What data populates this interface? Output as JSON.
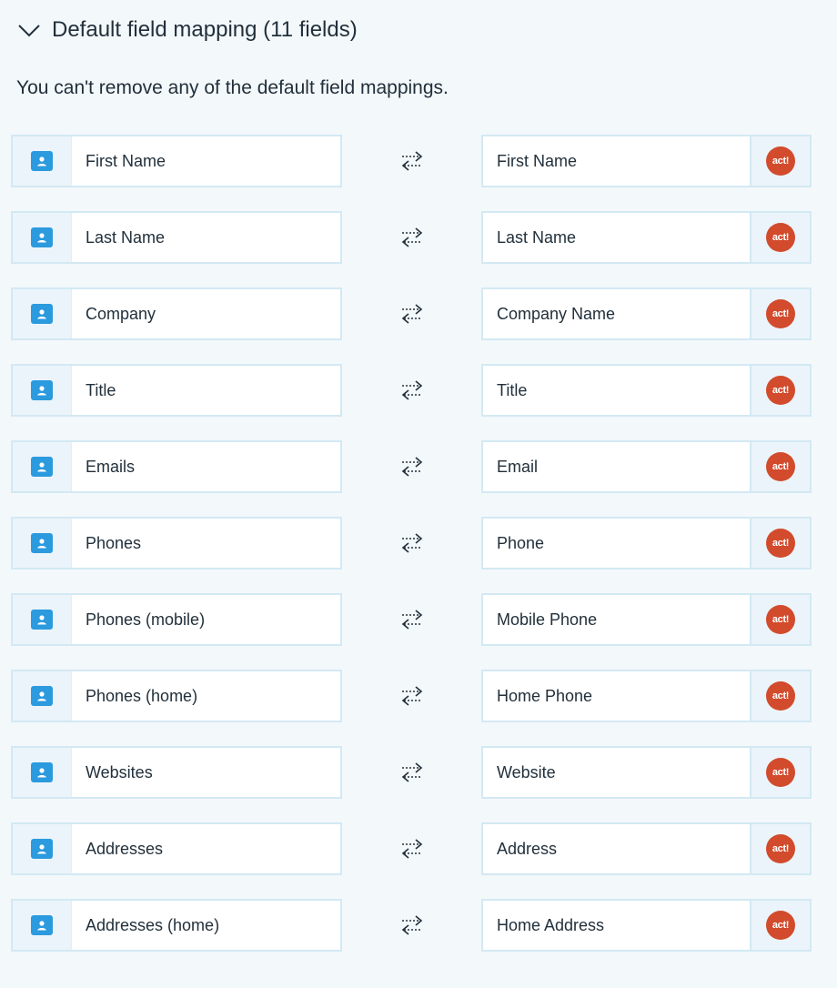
{
  "section": {
    "title": "Default field mapping (11 fields)",
    "note": "You can't remove any of the default field mappings.",
    "icons": {
      "toggle": "chevron-down-icon",
      "source": "contact-card-icon",
      "target": "act-logo-icon",
      "mapping": "two-way-sync-icon"
    },
    "target_badge_text": "act!"
  },
  "colors": {
    "source_icon": "#2b9ade",
    "target_icon": "#d24b2c",
    "border": "#d3e9f3",
    "background": "#f3f8fb"
  },
  "mappings": [
    {
      "source": "First Name",
      "target": "First Name"
    },
    {
      "source": "Last Name",
      "target": "Last Name"
    },
    {
      "source": "Company",
      "target": "Company Name"
    },
    {
      "source": "Title",
      "target": "Title"
    },
    {
      "source": "Emails",
      "target": "Email"
    },
    {
      "source": "Phones",
      "target": "Phone"
    },
    {
      "source": "Phones (mobile)",
      "target": "Mobile Phone"
    },
    {
      "source": "Phones (home)",
      "target": "Home Phone"
    },
    {
      "source": "Websites",
      "target": "Website"
    },
    {
      "source": "Addresses",
      "target": "Address"
    },
    {
      "source": "Addresses (home)",
      "target": "Home Address"
    }
  ]
}
